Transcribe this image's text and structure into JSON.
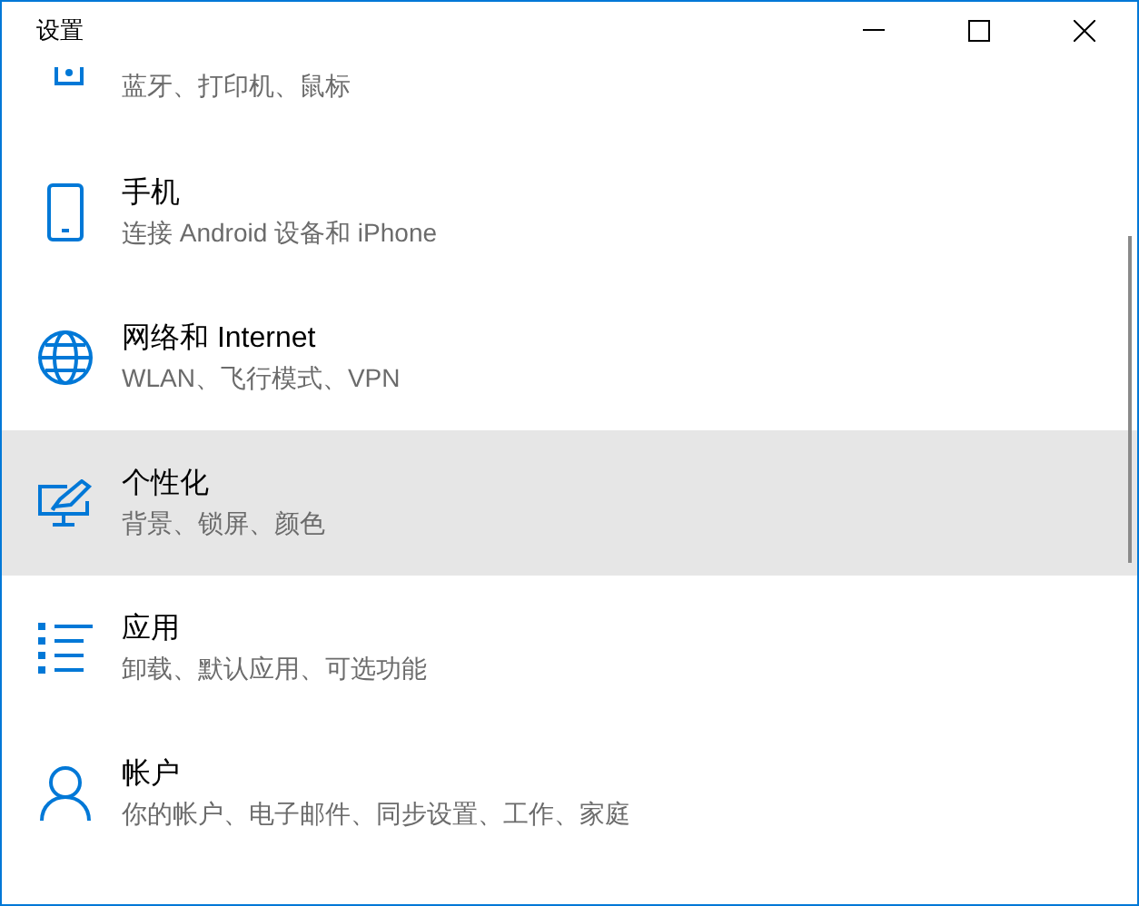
{
  "window": {
    "title": "设置"
  },
  "items": [
    {
      "kind": "partial",
      "subtitle": "蓝牙、打印机、鼠标",
      "selected": false
    },
    {
      "kind": "full",
      "title": "手机",
      "subtitle": "连接 Android 设备和 iPhone",
      "selected": false
    },
    {
      "kind": "full",
      "title": "网络和 Internet",
      "subtitle": "WLAN、飞行模式、VPN",
      "selected": false
    },
    {
      "kind": "full",
      "title": "个性化",
      "subtitle": "背景、锁屏、颜色",
      "selected": true
    },
    {
      "kind": "full",
      "title": "应用",
      "subtitle": "卸载、默认应用、可选功能",
      "selected": false
    },
    {
      "kind": "full",
      "title": "帐户",
      "subtitle": "你的帐户、电子邮件、同步设置、工作、家庭",
      "selected": false
    }
  ]
}
